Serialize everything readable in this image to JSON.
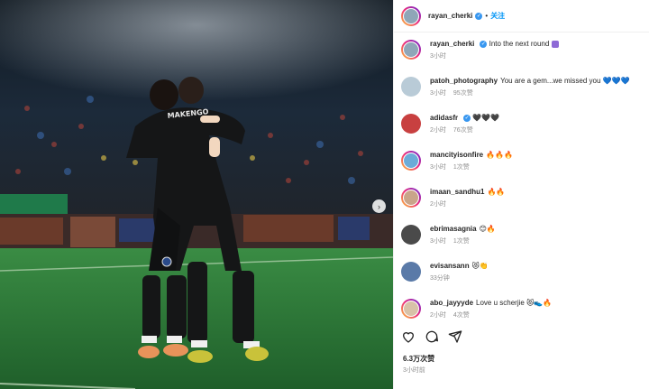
{
  "header": {
    "username": "rayan_cherki",
    "separator": "•",
    "follow_label": "关注"
  },
  "photo": {
    "shirt_name": "MAKENGO"
  },
  "caption": {
    "username": "rayan_cherki",
    "text": "Into the next round",
    "time": "3小时"
  },
  "comments": [
    {
      "username": "patoh_photography",
      "text": "You are a gem...we missed you 💙💙💙",
      "time": "3小时",
      "likes": "95次赞"
    },
    {
      "username": "adidasfr",
      "text": "🖤🖤🖤",
      "time": "2小时",
      "likes": "76次赞"
    },
    {
      "username": "mancityisonfire",
      "text": "🔥🔥🔥",
      "time": "3小时",
      "likes": "1次赞"
    },
    {
      "username": "imaan_sandhu1",
      "text": "🔥🔥",
      "time": "2小时",
      "likes": ""
    },
    {
      "username": "ebrimasagnia",
      "text": "😊🔥",
      "time": "3小时",
      "likes": "1次赞"
    },
    {
      "username": "evisansann",
      "text": "😻👏",
      "time": "33分钟",
      "likes": ""
    },
    {
      "username": "abo_jayyyde",
      "text": "Love u scherjie 😻👟🔥",
      "time": "2小时",
      "likes": "4次赞"
    }
  ],
  "post": {
    "likes": "6.3万次赞",
    "time": "3小时前"
  },
  "colors": {
    "accent": "#0095f6",
    "verified": "#3897f0",
    "pitch": "#2f7a3a"
  },
  "icons": [
    "heart-icon",
    "comment-icon",
    "share-icon",
    "verified-icon",
    "next-arrow-icon"
  ]
}
